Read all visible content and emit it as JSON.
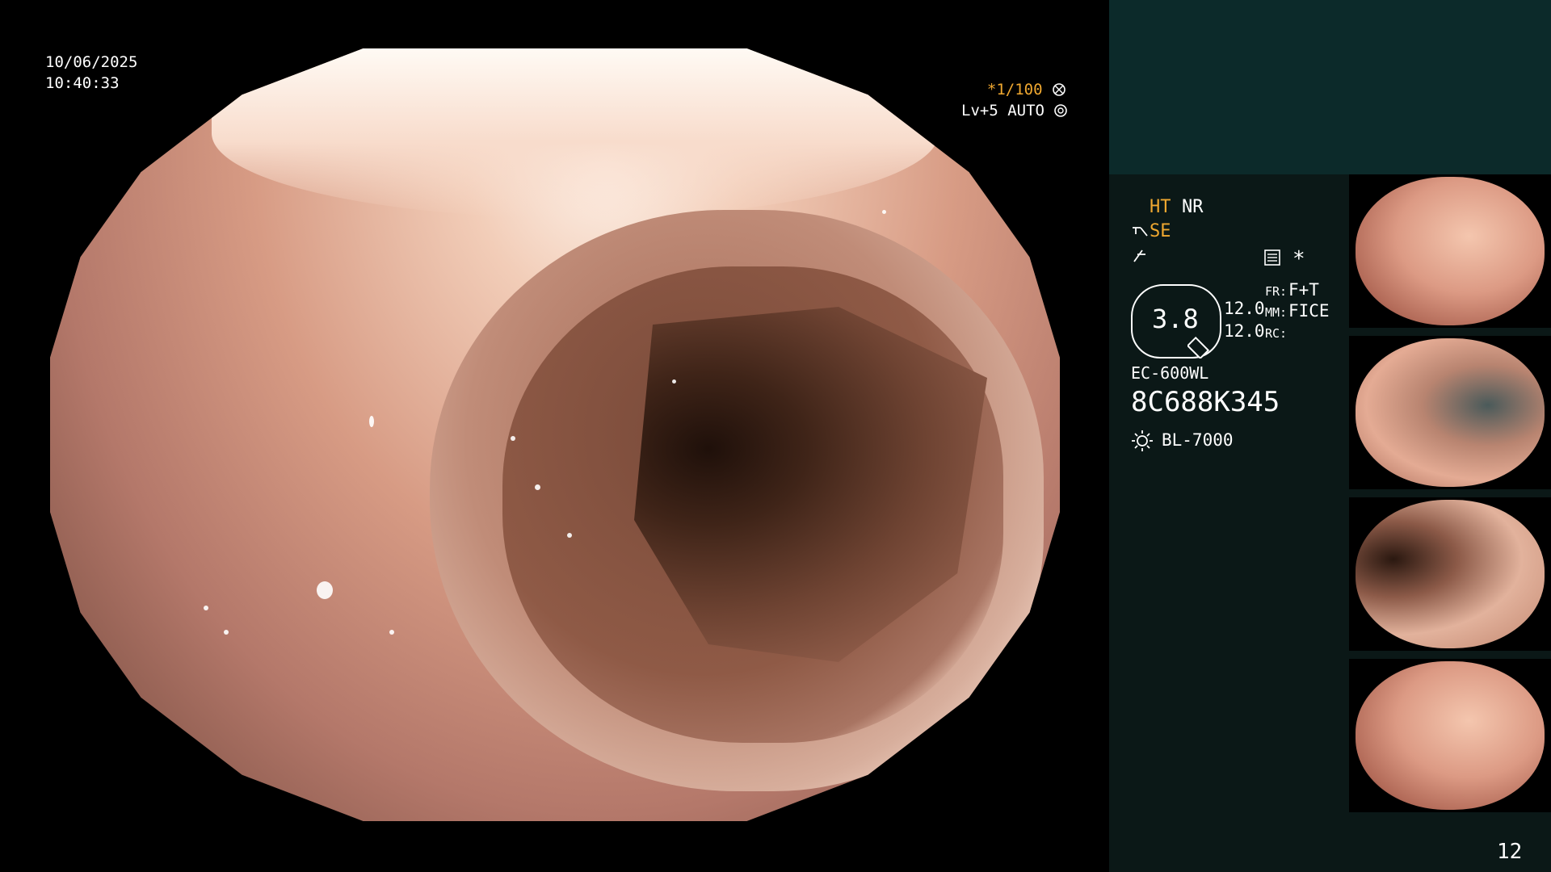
{
  "osd": {
    "date": "10/06/2025",
    "time": "10:40:33",
    "shutter_prefix": "*",
    "shutter": "1/100",
    "level": "Lv+5",
    "iris": "AUTO"
  },
  "settings": {
    "ht": "HT",
    "nr": "NR",
    "se": "SE",
    "magnification": "3.8",
    "val1": "12.0",
    "val2": "12.0",
    "fr_label": "FR:",
    "fr_value": "F+T",
    "mm_label": "MM:",
    "mm_value": "FICE",
    "rc_label": "RC:",
    "star": "*"
  },
  "scope": {
    "model": "EC-600WL",
    "serial": "8C688K345",
    "light_source": "BL-7000"
  },
  "thumbnails": {
    "count": 4
  },
  "page_number": "12",
  "colors": {
    "accent_amber": "#f0a830",
    "panel_bg": "#0b1817",
    "panel_top": "#0c2a2a"
  },
  "icons": [
    "shutter-icon",
    "iris-icon",
    "se-icon",
    "freeze-icon",
    "memory-icon",
    "light-icon"
  ]
}
